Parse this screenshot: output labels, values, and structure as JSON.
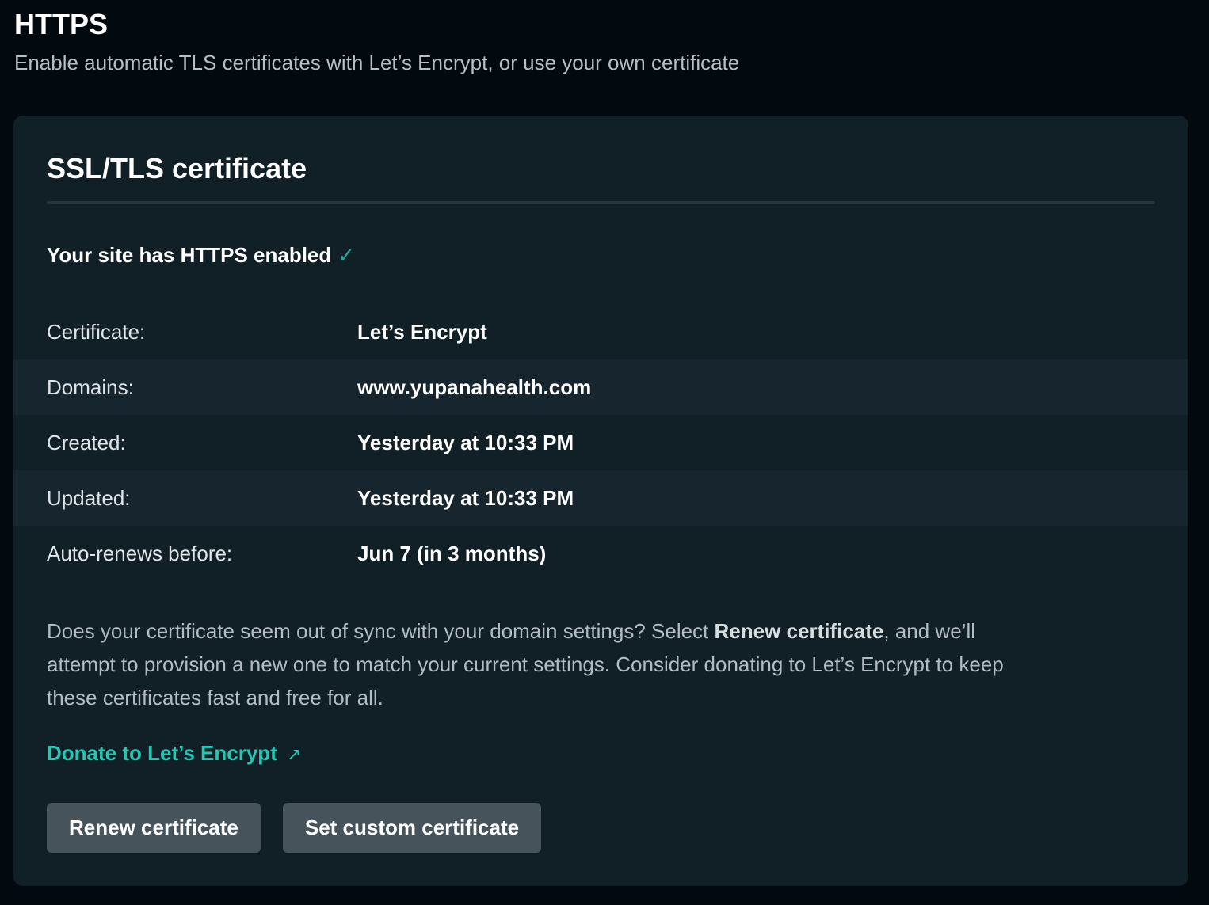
{
  "header": {
    "title": "HTTPS",
    "subtitle": "Enable automatic TLS certificates with Let’s Encrypt, or use your own certificate"
  },
  "card": {
    "title": "SSL/TLS certificate",
    "status": "Your site has HTTPS enabled",
    "status_icon": "✓",
    "details": [
      {
        "label": "Certificate:",
        "value": "Let’s Encrypt"
      },
      {
        "label": "Domains:",
        "value": "www.yupanahealth.com"
      },
      {
        "label": "Created:",
        "value": "Yesterday at 10:33 PM"
      },
      {
        "label": "Updated:",
        "value": "Yesterday at 10:33 PM"
      },
      {
        "label": "Auto-renews before:",
        "value": "Jun 7 (in 3 months)"
      }
    ],
    "help": {
      "before": "Does your certificate seem out of sync with your domain settings? Select ",
      "emphasis": "Renew certificate",
      "after": ", and we’ll attempt to provision a new one to match your current settings. Consider donating to Let’s Encrypt to keep these certificates fast and free for all."
    },
    "donate_link": {
      "label": "Donate to Let’s Encrypt",
      "icon": "↗"
    },
    "buttons": {
      "renew": "Renew certificate",
      "custom": "Set custom certificate"
    }
  },
  "colors": {
    "background": "#030a0f",
    "card": "#111f27",
    "accent": "#24c8b4",
    "button": "#47535a"
  }
}
